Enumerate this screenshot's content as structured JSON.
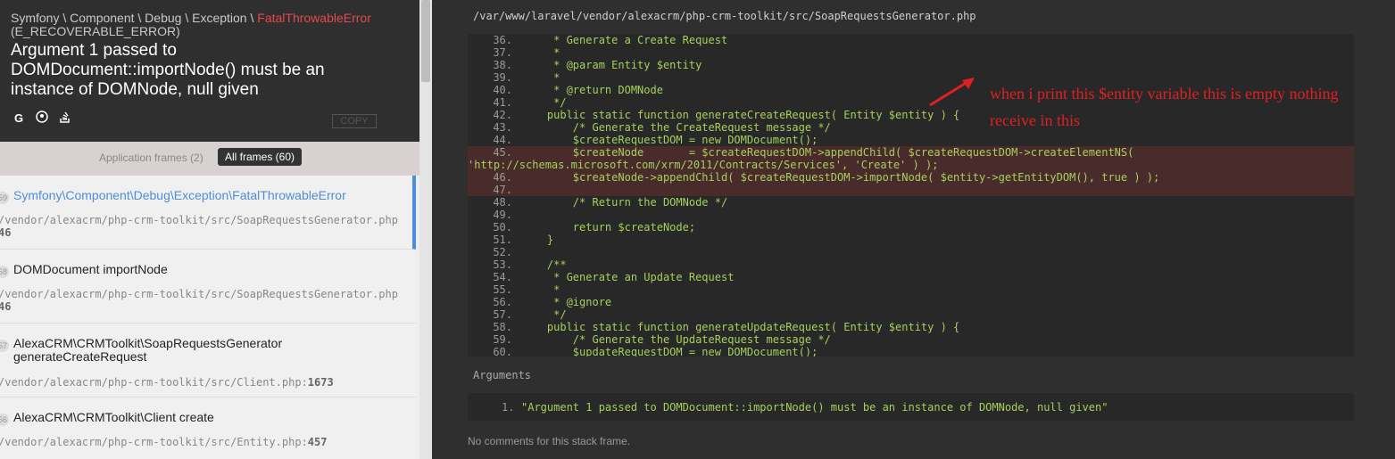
{
  "header": {
    "path_prefix": "Symfony \\ Component \\ Debug \\ Exception \\ ",
    "path_highlight": "FatalThrowableError",
    "code": "(E_RECOVERABLE_ERROR)",
    "message": "Argument 1 passed to DOMDocument::importNode() must be an instance of DOMNode, null given",
    "copy_label": "COPY",
    "icons": [
      "google-icon",
      "duckduckgo-icon",
      "stackoverflow-icon"
    ]
  },
  "filter": {
    "app_frames": "Application frames (2)",
    "all_frames": "All frames (60)"
  },
  "frames": [
    {
      "num": "59",
      "cls": "Symfony\\Component\\Debug\\Exception\\FatalThrowableError",
      "file": "/vendor/alexacrm/php-crm-toolkit/src/SoapRequestsGenerator.php",
      "line": "46"
    },
    {
      "num": "58",
      "cls": "DOMDocument importNode",
      "file": "/vendor/alexacrm/php-crm-toolkit/src/SoapRequestsGenerator.php",
      "line": "46"
    },
    {
      "num": "57",
      "cls": "AlexaCRM\\CRMToolkit\\SoapRequestsGenerator generateCreateRequest",
      "file": "/vendor/alexacrm/php-crm-toolkit/src/Client.php",
      "line": "1673"
    },
    {
      "num": "56",
      "cls": "AlexaCRM\\CRMToolkit\\Client create",
      "file": "/vendor/alexacrm/php-crm-toolkit/src/Entity.php",
      "line": "457"
    }
  ],
  "main": {
    "file_path": "/var/www/laravel/vendor/alexacrm/php-crm-toolkit/src/SoapRequestsGenerator.php",
    "code_lines": [
      {
        "n": "36.",
        "t": "     * Generate a Create Request"
      },
      {
        "n": "37.",
        "t": "     *"
      },
      {
        "n": "38.",
        "t": "     * @param Entity $entity"
      },
      {
        "n": "39.",
        "t": "     *"
      },
      {
        "n": "40.",
        "t": "     * @return DOMNode"
      },
      {
        "n": "41.",
        "t": "     */"
      },
      {
        "n": "42.",
        "t": "    public static function generateCreateRequest( Entity $entity ) {"
      },
      {
        "n": "43.",
        "t": "        /* Generate the CreateRequest message */"
      },
      {
        "n": "44.",
        "t": "        $createRequestDOM = new DOMDocument();"
      },
      {
        "n": "45.",
        "t": "        $createNode       = $createRequestDOM->appendChild( $createRequestDOM->createElementNS(",
        "hl": true
      },
      {
        "n": "",
        "t": "'http://schemas.microsoft.com/xrm/2011/Contracts/Services', 'Create' ) );",
        "hl": true,
        "wrap": true
      },
      {
        "n": "46.",
        "t": "        $createNode->appendChild( $createRequestDOM->importNode( $entity->getEntityDOM(), true ) );",
        "hl": true
      },
      {
        "n": "47.",
        "t": "",
        "hl": true
      },
      {
        "n": "48.",
        "t": "        /* Return the DOMNode */"
      },
      {
        "n": "49.",
        "t": ""
      },
      {
        "n": "50.",
        "t": "        return $createNode;"
      },
      {
        "n": "51.",
        "t": "    }"
      },
      {
        "n": "52.",
        "t": ""
      },
      {
        "n": "53.",
        "t": "    /**"
      },
      {
        "n": "54.",
        "t": "     * Generate an Update Request"
      },
      {
        "n": "55.",
        "t": "     *"
      },
      {
        "n": "56.",
        "t": "     * @ignore"
      },
      {
        "n": "57.",
        "t": "     */"
      },
      {
        "n": "58.",
        "t": "    public static function generateUpdateRequest( Entity $entity ) {"
      },
      {
        "n": "59.",
        "t": "        /* Generate the UpdateRequest message */"
      },
      {
        "n": "60.",
        "t": "        $updateRequestDOM = new DOMDocument();"
      }
    ],
    "arguments_label": "Arguments",
    "argument_num": "1.",
    "argument_value": "\"Argument 1 passed to DOMDocument::importNode() must be an instance of DOMNode, null given\"",
    "no_comments": "No comments for this stack frame.",
    "annotation": "when i print this $entity variable this is empty nothing receive in this"
  }
}
